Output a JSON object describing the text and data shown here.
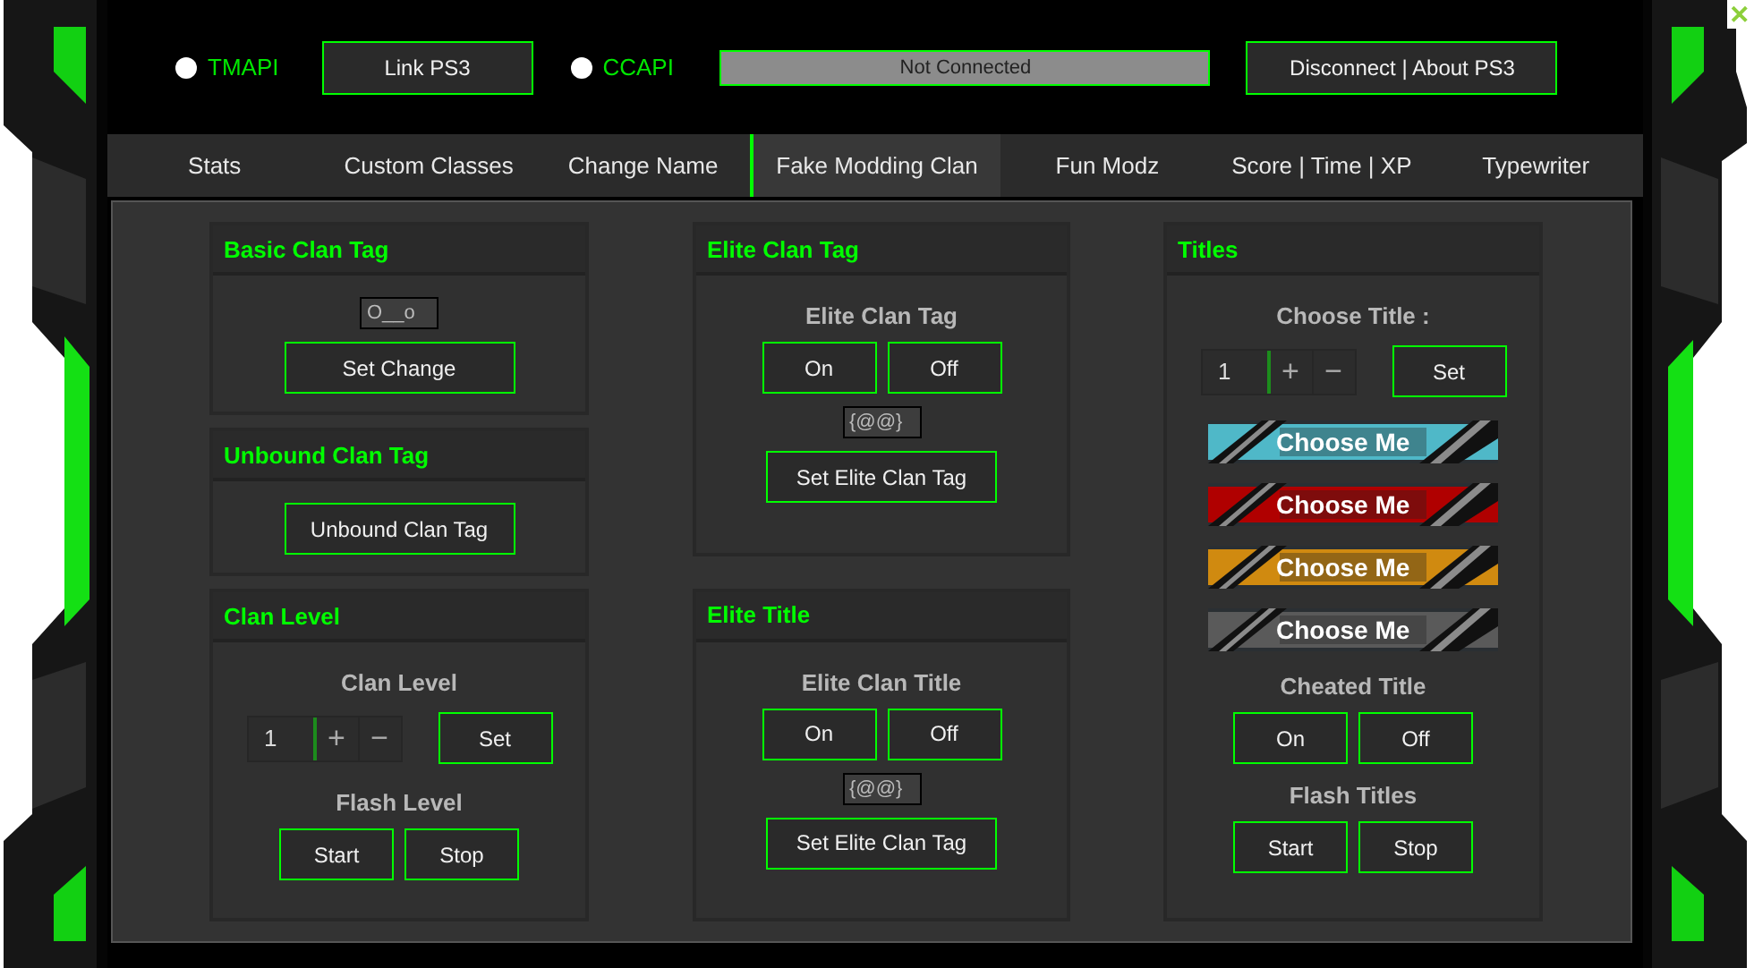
{
  "top_bar": [
    {
      "kind": "radio",
      "label": "TMAPI",
      "selected": false
    },
    {
      "kind": "button",
      "label": "Link PS3"
    },
    {
      "kind": "radio",
      "label": "CCAPI",
      "selected": false
    },
    {
      "kind": "status",
      "label": "Not Connected"
    },
    {
      "kind": "button",
      "label": "Disconnect | About PS3"
    }
  ],
  "close": "✕",
  "tabs": [
    {
      "label": "Stats",
      "selected": false
    },
    {
      "label": "Custom Classes",
      "selected": false
    },
    {
      "label": "Change Name",
      "selected": false
    },
    {
      "label": "Fake Modding Clan",
      "selected": true
    },
    {
      "label": "Fun Modz",
      "selected": false
    },
    {
      "label": "Score | Time | XP",
      "selected": false
    },
    {
      "label": "Typewriter",
      "selected": false
    }
  ],
  "columns": [
    [
      {
        "title": "Basic Clan Tag",
        "items": [
          {
            "kind": "input",
            "value": "O__o"
          },
          {
            "kind": "button",
            "label": "Set Change"
          }
        ]
      },
      {
        "title": "Unbound Clan Tag",
        "items": [
          {
            "kind": "button",
            "label": "Unbound Clan Tag"
          }
        ]
      },
      {
        "title": "Clan Level",
        "items": [
          {
            "kind": "heading",
            "text": "Clan Level"
          },
          {
            "kind": "stepper",
            "value": "1",
            "plus": "+",
            "minus": "−",
            "button": "Set"
          },
          {
            "kind": "heading",
            "text": "Flash Level"
          },
          {
            "kind": "pair",
            "labels": [
              "Start",
              "Stop"
            ]
          }
        ]
      }
    ],
    [
      {
        "title": "Elite Clan Tag",
        "items": [
          {
            "kind": "heading",
            "text": "Elite Clan Tag"
          },
          {
            "kind": "pair",
            "labels": [
              "On",
              "Off"
            ]
          },
          {
            "kind": "input",
            "value": "{@@}"
          },
          {
            "kind": "button",
            "label": "Set Elite Clan Tag"
          }
        ]
      },
      {
        "title": "Elite Title",
        "items": [
          {
            "kind": "heading",
            "text": "Elite Clan Title"
          },
          {
            "kind": "pair",
            "labels": [
              "On",
              "Off"
            ]
          },
          {
            "kind": "input",
            "value": "{@@}"
          },
          {
            "kind": "button",
            "label": "Set Elite Clan Tag"
          }
        ]
      }
    ],
    [
      {
        "title": "Titles",
        "items": [
          {
            "kind": "heading",
            "text": "Choose Title :"
          },
          {
            "kind": "stepper",
            "value": "1",
            "plus": "+",
            "minus": "−",
            "button": "Set"
          },
          {
            "kind": "banner",
            "label": "Choose Me",
            "color": "#4fb8c8"
          },
          {
            "kind": "banner",
            "label": "Choose Me",
            "color": "#b00000"
          },
          {
            "kind": "banner",
            "label": "Choose Me",
            "color": "#d08a10"
          },
          {
            "kind": "banner",
            "label": "Choose Me",
            "color": "#5a5a5a"
          },
          {
            "kind": "heading",
            "text": "Cheated Title"
          },
          {
            "kind": "pair",
            "labels": [
              "On",
              "Off"
            ]
          },
          {
            "kind": "heading",
            "text": "Flash Titles"
          },
          {
            "kind": "pair",
            "labels": [
              "Start",
              "Stop"
            ]
          }
        ]
      }
    ]
  ]
}
